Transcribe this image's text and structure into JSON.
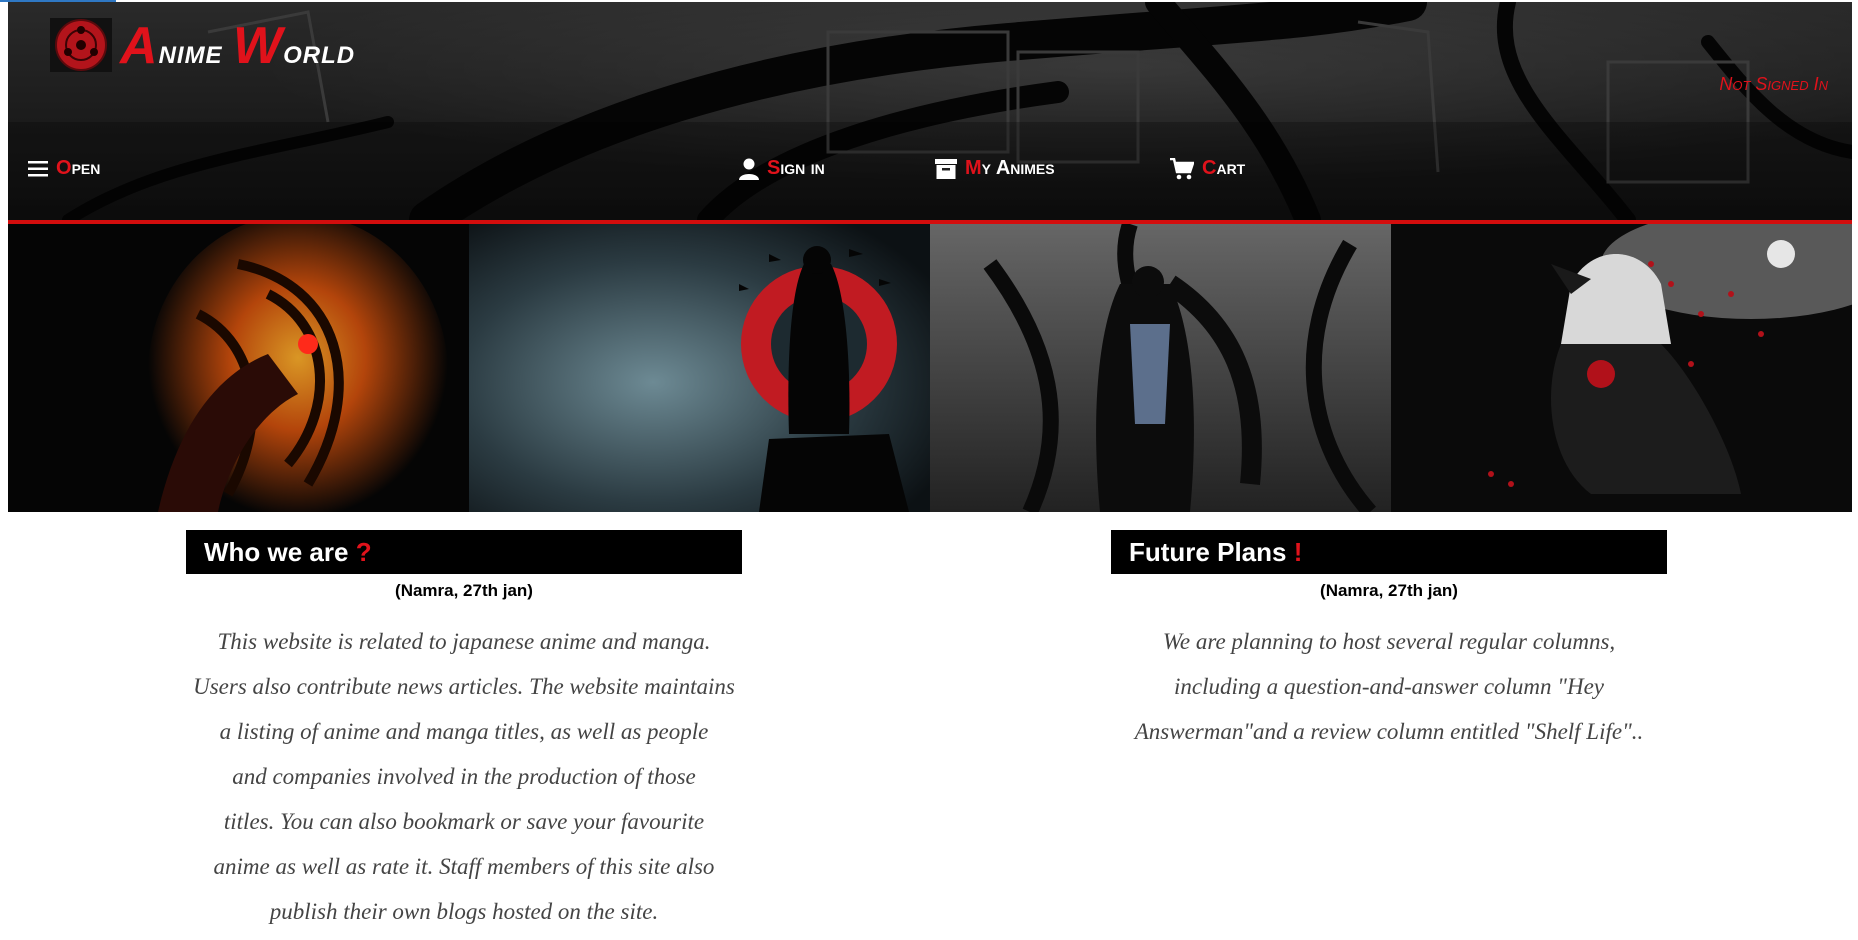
{
  "site": {
    "logo_initial_1": "A",
    "logo_rest_1": "nime",
    "logo_initial_2": "W",
    "logo_rest_2": "orld",
    "auth_status": "Not Signed In"
  },
  "nav": {
    "open": {
      "first": "O",
      "rest": "pen",
      "icon": "hamburger-icon"
    },
    "sign_in": {
      "first": "S",
      "rest": "ign in",
      "icon": "user-icon"
    },
    "my_animes": {
      "first": "M",
      "rest": "y Animes",
      "icon": "archive-icon"
    },
    "cart": {
      "first": "C",
      "rest": "art",
      "icon": "cart-icon"
    }
  },
  "colors": {
    "accent": "#e0121b",
    "header_bg": "#1b1b1b",
    "card_title_bg": "#000000"
  },
  "sections": [
    {
      "title": "Who we are",
      "title_mark": "?",
      "byline": "(Namra, 27th jan)",
      "body": "This website is related to japanese anime and manga.\nUsers also contribute news articles. The website maintains\na listing of anime and manga titles, as well as people\nand companies involved in the production of those\ntitles. You can also bookmark or save your favourite\nanime as well as rate it. Staff members of this site also\npublish their own blogs hosted on the site."
    },
    {
      "title": "Future Plans",
      "title_mark": "!",
      "byline": "(Namra, 27th jan)",
      "body": "We are planning to host several regular columns,\nincluding a question-and-answer column \"Hey\nAnswerman\"and a review column entitled \"Shelf Life\".."
    }
  ]
}
